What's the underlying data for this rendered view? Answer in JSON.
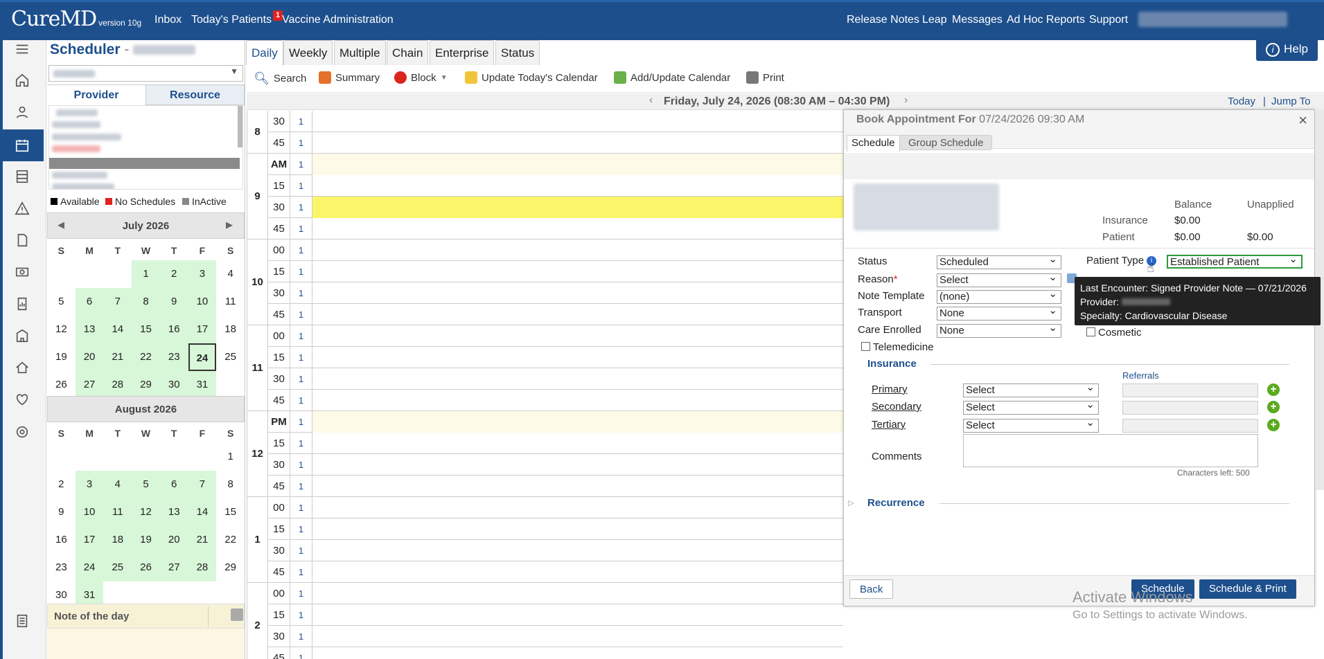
{
  "topbar": {
    "logo": "CureMD",
    "version": "version 10g",
    "inbox": "Inbox",
    "todays_patients": "Today's Patients",
    "badge": "1",
    "vaccine": "Vaccine Administration",
    "release_notes": "Release Notes",
    "leap": "Leap",
    "messages": "Messages",
    "adhoc": "Ad Hoc Reports",
    "support": "Support",
    "help": "Help"
  },
  "left": {
    "title": "Scheduler",
    "title_sep": "-",
    "tab_provider": "Provider",
    "tab_resource": "Resource",
    "legend_available": "Available",
    "legend_no_schedules": "No Schedules",
    "legend_inactive": "InActive",
    "note_of_day": "Note of the day",
    "colors": {
      "available": "#000000",
      "no_schedules": "#e0221f",
      "inactive": "#888888",
      "available_day": "#d8f6d8"
    }
  },
  "cal1": {
    "title": "July 2026",
    "dow": [
      "S",
      "M",
      "T",
      "W",
      "T",
      "F",
      "S"
    ]
  },
  "cal2": {
    "title": "August 2026",
    "dow": [
      "S",
      "M",
      "T",
      "W",
      "T",
      "F",
      "S"
    ]
  },
  "tabs": [
    "Daily",
    "Weekly",
    "Multiple",
    "Chain",
    "Enterprise",
    "Status"
  ],
  "toolbar": {
    "search": "Search",
    "summary": "Summary",
    "block": "Block",
    "update_today": "Update Today's Calendar",
    "add_update": "Add/Update Calendar",
    "print": "Print"
  },
  "datebar": {
    "date": "Friday, July 24, 2026 (08:30 AM – 04:30 PM)",
    "today": "Today",
    "sep": "|",
    "jump": "Jump To"
  },
  "modal": {
    "title": "Book Appointment For",
    "title_date": "07/24/2026 09:30 AM",
    "tab_schedule": "Schedule",
    "tab_group": "Group Schedule",
    "balance": "Balance",
    "unapplied": "Unapplied",
    "insurance": "Insurance",
    "patient": "Patient",
    "ins_balance": "$0.00",
    "pat_balance": "$0.00",
    "pat_unapplied": "$0.00",
    "status_lbl": "Status",
    "status_val": "Scheduled",
    "reason_lbl": "Reason",
    "reason_val": "Select",
    "note_lbl": "Note Template",
    "note_val": "(none)",
    "transport_lbl": "Transport",
    "transport_val": "None",
    "care_lbl": "Care Enrolled",
    "care_val": "None",
    "telemed": "Telemedicine",
    "ptype_lbl": "Patient Type",
    "ptype_val": "Established Patient",
    "cosmetic": "Cosmetic",
    "insurance_hdr": "Insurance",
    "referrals": "Referrals",
    "primary": "Primary",
    "secondary": "Secondary",
    "tertiary": "Tertiary",
    "select": "Select",
    "comments": "Comments",
    "chars_left": "Characters left: 500",
    "recurrence": "Recurrence",
    "back": "Back",
    "schedule": "Schedule",
    "schedule_print": "Schedule & Print"
  },
  "tooltip": {
    "line1": "Last Encounter: Signed Provider Note — 07/21/2026",
    "line2": "Provider:",
    "line3": "Specialty: Cardiovascular Disease"
  },
  "watermark": {
    "line1": "Activate Windows",
    "line2": "Go to Settings to activate Windows."
  }
}
